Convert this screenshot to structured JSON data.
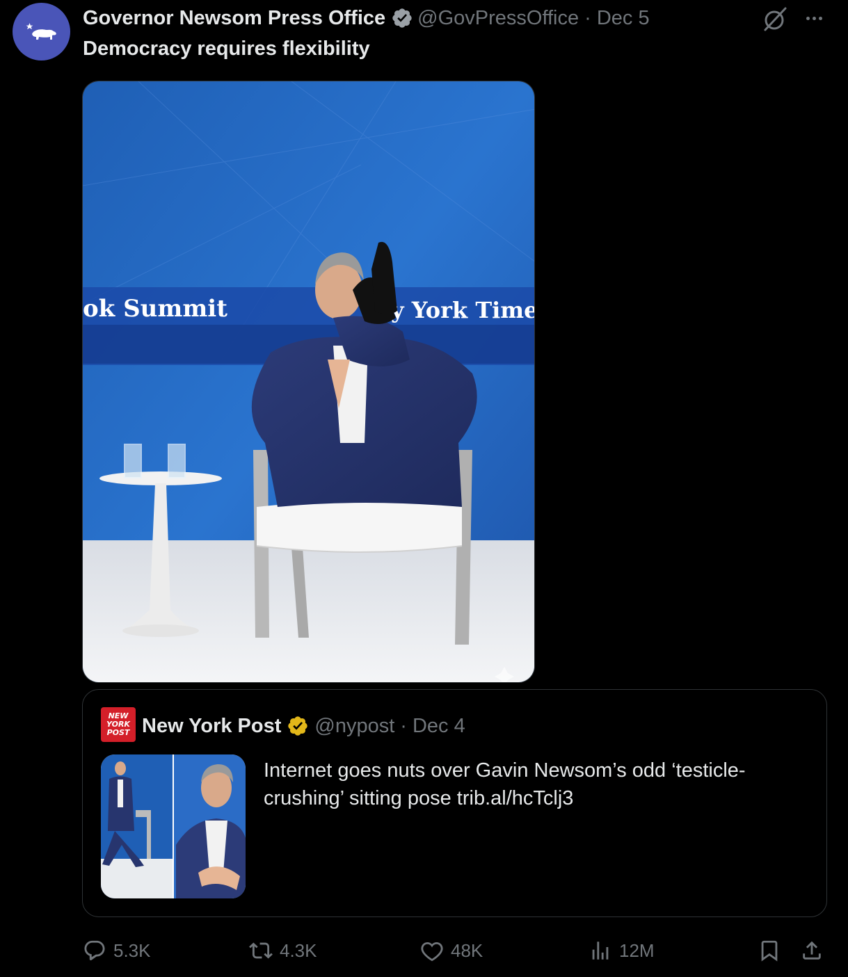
{
  "tweet": {
    "author_name": "Governor Newsom Press Office",
    "handle": "@GovPressOffice",
    "separator": "·",
    "date": "Dec 5",
    "text": "Democracy requires flexibility",
    "image_sign_left": "ok Summit",
    "image_sign_right": "y York Times"
  },
  "quote": {
    "author_name": "New York Post",
    "logo_text": [
      "NEW",
      "YORK",
      "POST"
    ],
    "handle": "@nypost",
    "separator": "·",
    "date": "Dec 4",
    "text": "Internet goes nuts over Gavin Newsom’s odd ‘testicle-crushing’ sitting pose trib.al/hcTclj3"
  },
  "actions": {
    "replies": "5.3K",
    "reposts": "4.3K",
    "likes": "48K",
    "views": "12M"
  },
  "colors": {
    "background": "#000000",
    "text": "#e7e9ea",
    "muted": "#71767b",
    "verified_blue": "#1d9bf0",
    "verified_gold": "#e2b719",
    "avatar": "#4a55b8",
    "nypost_red": "#d41f29"
  },
  "icons": [
    "grok-icon",
    "more-icon",
    "verified-badge-icon",
    "reply-icon",
    "repost-icon",
    "like-icon",
    "views-icon",
    "bookmark-icon",
    "share-icon"
  ]
}
